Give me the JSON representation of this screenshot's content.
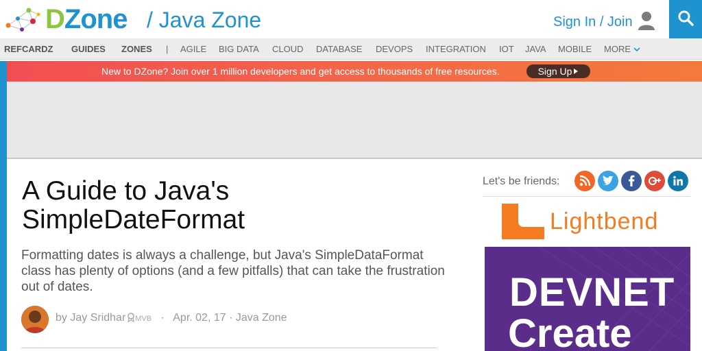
{
  "header": {
    "brand_first": "D",
    "brand_rest": "Zone",
    "zone_title": "/ Java Zone",
    "signin_label": "Sign In / Join",
    "brand_color_green": "#8cc63f",
    "brand_color_blue": "#1e93d0",
    "icons": [
      "dzone-network-logo",
      "user-icon",
      "search-icon"
    ]
  },
  "nav": {
    "primary": [
      "REFCARDZ",
      "GUIDES",
      "ZONES"
    ],
    "separator": "|",
    "zones": [
      "AGILE",
      "BIG DATA",
      "CLOUD",
      "DATABASE",
      "DEVOPS",
      "INTEGRATION",
      "IOT",
      "JAVA",
      "MOBILE"
    ],
    "more_label": "MORE"
  },
  "promo": {
    "text": "New to DZone? Join over 1 million developers and get access to thousands of free resources.",
    "signup_label": "Sign Up"
  },
  "article": {
    "title_line1": "A Guide to Java's",
    "title_line2": "SimpleDateFormat",
    "summary": "Formatting dates is always a challenge, but Java's SimpleDataFormat class has plenty of options (and a few pitfalls) that can take the frustration out of dates.",
    "author_prefix": "by",
    "author": "Jay Sridhar",
    "badge": "MVB",
    "date": "Apr. 02, 17",
    "zone": "Java Zone",
    "meta_separator": "·"
  },
  "sidebar": {
    "friends_label": "Let's be friends:",
    "social": [
      {
        "name": "rss",
        "color": "#f26522"
      },
      {
        "name": "twitter",
        "color": "#3aa3e3"
      },
      {
        "name": "facebook",
        "color": "#3b5998"
      },
      {
        "name": "google-plus",
        "color": "#dd4b39"
      },
      {
        "name": "linkedin",
        "color": "#0e76a8"
      }
    ],
    "sponsor_text": "Lightbend",
    "sponsor_color": "#f47b20",
    "ad_line1": "DEVNET",
    "ad_line2": "Create",
    "ad_bg": "#5a2d8a"
  }
}
